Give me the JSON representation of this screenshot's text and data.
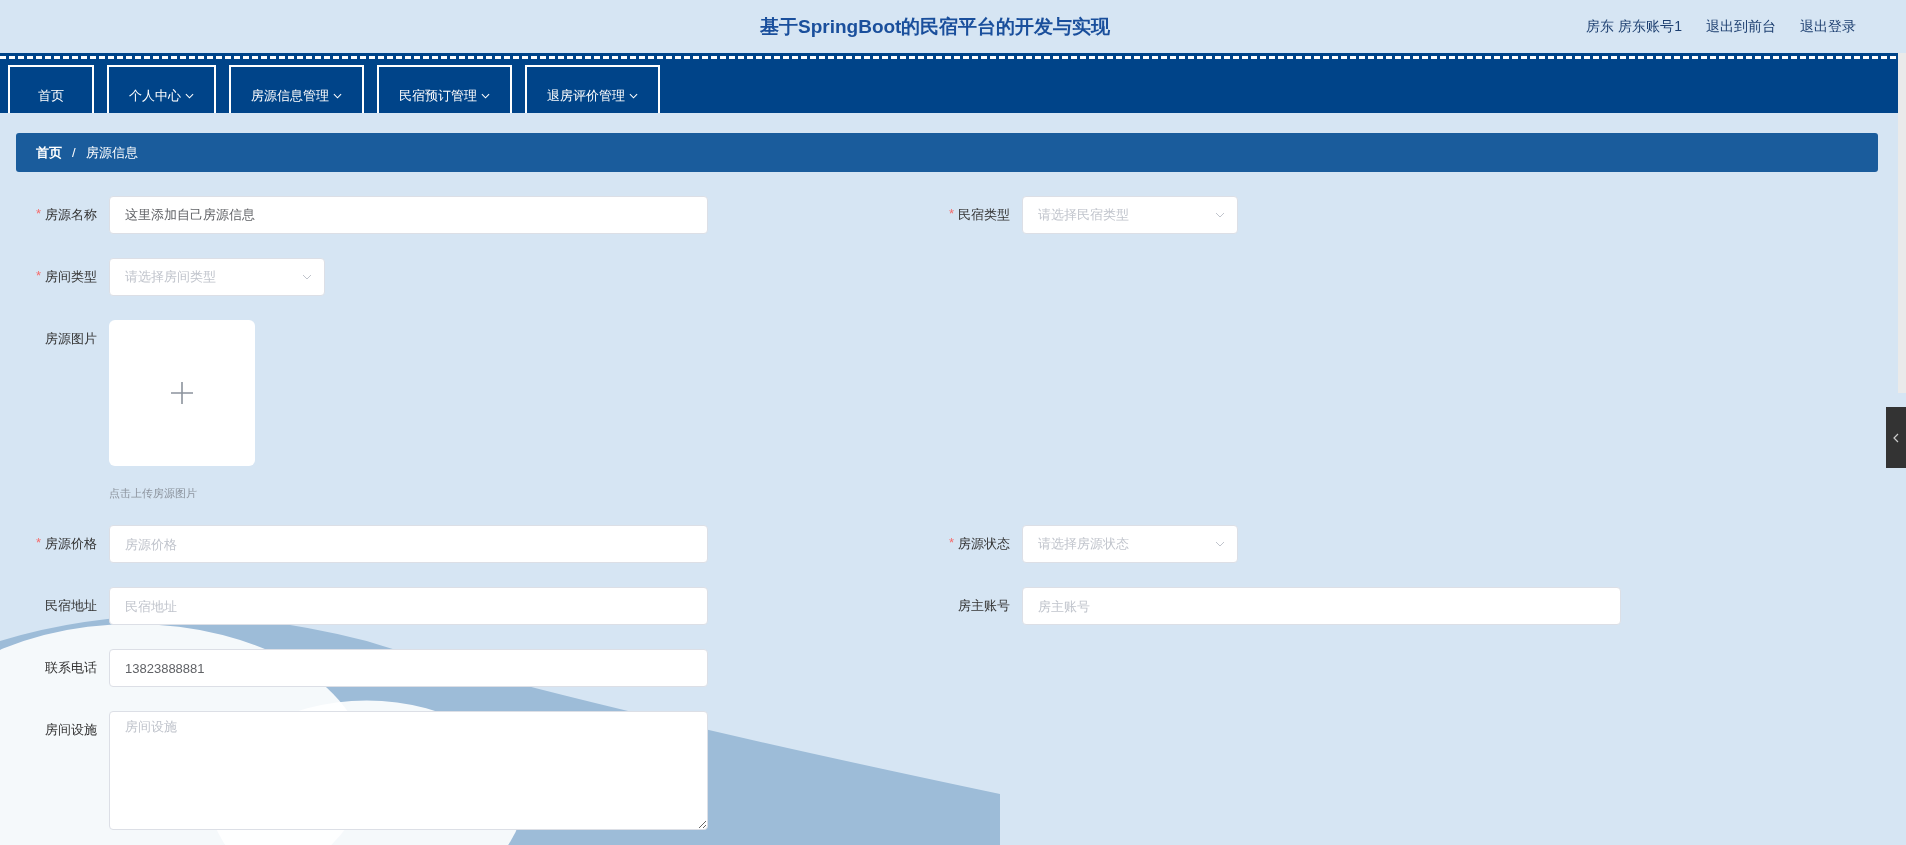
{
  "header": {
    "title": "基于SpringBoot的民宿平台的开发与实现",
    "links": [
      "房东 房东账号1",
      "退出到前台",
      "退出登录"
    ]
  },
  "nav": [
    {
      "label": "首页",
      "has_menu": false
    },
    {
      "label": "个人中心",
      "has_menu": true
    },
    {
      "label": "房源信息管理",
      "has_menu": true
    },
    {
      "label": "民宿预订管理",
      "has_menu": true
    },
    {
      "label": "退房评价管理",
      "has_menu": true
    }
  ],
  "breadcrumb": {
    "items": [
      "首页",
      "房源信息"
    ],
    "separator": "/"
  },
  "form": {
    "rows": [
      {
        "fields": [
          {
            "kind": "input",
            "label": "房源名称",
            "required_mark": "*",
            "value": "这里添加自己房源信息"
          },
          {
            "kind": "select",
            "label": "民宿类型",
            "required_mark": "*",
            "placeholder": "请选择民宿类型"
          }
        ]
      },
      {
        "fields": [
          {
            "kind": "select",
            "label": "房间类型",
            "required_mark": "*",
            "placeholder": "请选择房间类型"
          }
        ]
      },
      {
        "fields": [
          {
            "kind": "upload",
            "label": "房源图片",
            "hint": "点击上传房源图片"
          }
        ]
      },
      {
        "fields": [
          {
            "kind": "input",
            "label": "房源价格",
            "required_mark": "*",
            "placeholder": "房源价格"
          },
          {
            "kind": "select",
            "label": "房源状态",
            "required_mark": "*",
            "placeholder": "请选择房源状态"
          }
        ]
      },
      {
        "fields": [
          {
            "kind": "input",
            "label": "民宿地址",
            "placeholder": "民宿地址"
          },
          {
            "kind": "input",
            "label": "房主账号",
            "placeholder": "房主账号"
          }
        ]
      },
      {
        "fields": [
          {
            "kind": "input",
            "label": "联系电话",
            "value": "13823888881"
          }
        ]
      },
      {
        "fields": [
          {
            "kind": "textarea",
            "label": "房间设施",
            "placeholder": "房间设施"
          }
        ]
      }
    ]
  }
}
